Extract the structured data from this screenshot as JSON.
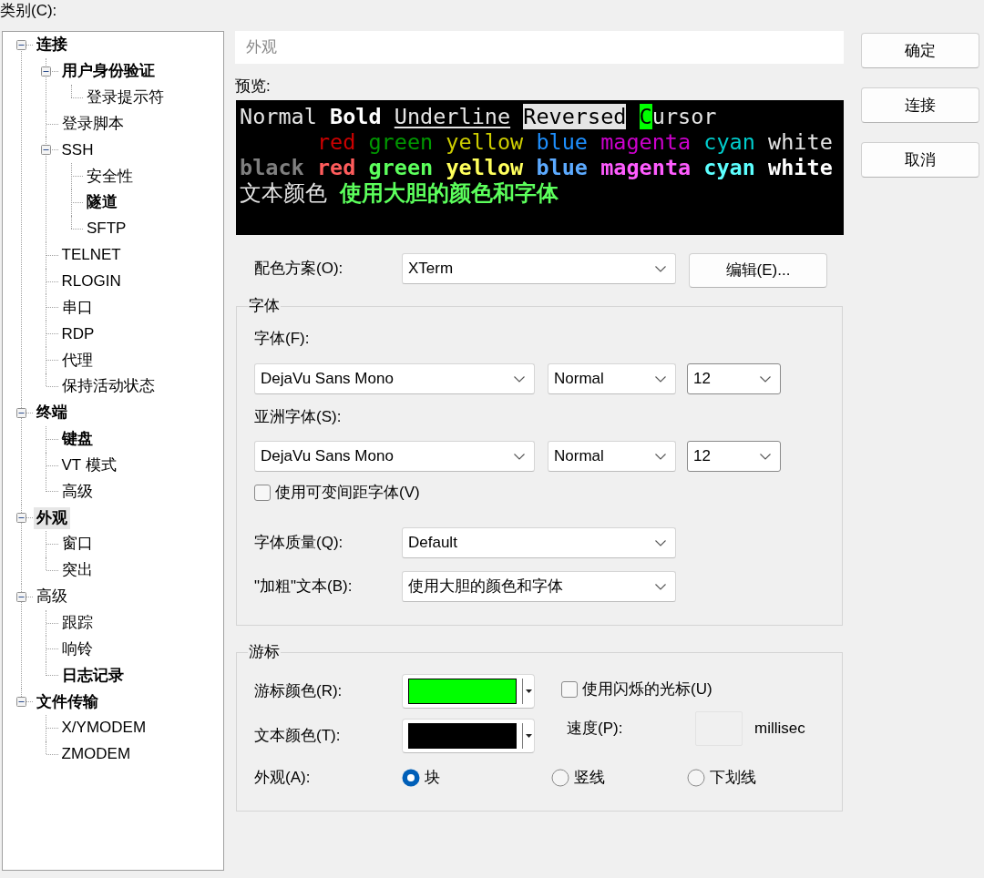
{
  "category_label": "类别(C):",
  "tree": [
    {
      "label": "连接",
      "bold": true,
      "selected": false,
      "expanded": true,
      "children": [
        {
          "label": "用户身份验证",
          "bold": true,
          "selected": false,
          "expanded": true,
          "children": [
            {
              "label": "登录提示符",
              "bold": false,
              "selected": false
            }
          ]
        },
        {
          "label": "登录脚本",
          "bold": false,
          "selected": false
        },
        {
          "label": "SSH",
          "bold": false,
          "selected": false,
          "expanded": true,
          "children": [
            {
              "label": "安全性",
              "bold": false,
              "selected": false
            },
            {
              "label": "隧道",
              "bold": true,
              "selected": false
            },
            {
              "label": "SFTP",
              "bold": false,
              "selected": false
            }
          ]
        },
        {
          "label": "TELNET",
          "bold": false,
          "selected": false
        },
        {
          "label": "RLOGIN",
          "bold": false,
          "selected": false
        },
        {
          "label": "串口",
          "bold": false,
          "selected": false
        },
        {
          "label": "RDP",
          "bold": false,
          "selected": false
        },
        {
          "label": "代理",
          "bold": false,
          "selected": false
        },
        {
          "label": "保持活动状态",
          "bold": false,
          "selected": false
        }
      ]
    },
    {
      "label": "终端",
      "bold": true,
      "selected": false,
      "expanded": true,
      "children": [
        {
          "label": "键盘",
          "bold": true,
          "selected": false
        },
        {
          "label": "VT 模式",
          "bold": false,
          "selected": false
        },
        {
          "label": "高级",
          "bold": false,
          "selected": false
        }
      ]
    },
    {
      "label": "外观",
      "bold": true,
      "selected": true,
      "expanded": true,
      "children": [
        {
          "label": "窗口",
          "bold": false,
          "selected": false
        },
        {
          "label": "突出",
          "bold": false,
          "selected": false
        }
      ]
    },
    {
      "label": "高级",
      "bold": false,
      "selected": false,
      "expanded": true,
      "children": [
        {
          "label": "跟踪",
          "bold": false,
          "selected": false
        },
        {
          "label": "响铃",
          "bold": false,
          "selected": false
        },
        {
          "label": "日志记录",
          "bold": true,
          "selected": false
        }
      ]
    },
    {
      "label": "文件传输",
      "bold": true,
      "selected": false,
      "expanded": true,
      "children": [
        {
          "label": "X/YMODEM",
          "bold": false,
          "selected": false
        },
        {
          "label": "ZMODEM",
          "bold": false,
          "selected": false
        }
      ]
    }
  ],
  "page_header": "外观",
  "preview": {
    "label": "预览:",
    "lines": [
      {
        "indented": false,
        "segments": [
          {
            "text": "Normal",
            "kind": "normal",
            "bold": false,
            "joined": false
          },
          {
            "text": "Bold",
            "kind": "normal",
            "bold": true,
            "joined": false
          },
          {
            "text": "Underline",
            "kind": "underline",
            "bold": false,
            "joined": false
          },
          {
            "text": "Reversed",
            "kind": "reversed",
            "bold": false,
            "joined": false
          },
          {
            "text": "C",
            "kind": "cursor",
            "bold": false,
            "joined": false
          },
          {
            "text": "ursor",
            "kind": "normal",
            "bold": false,
            "joined": true
          }
        ]
      },
      {
        "indented": true,
        "segments": [
          {
            "text": "red",
            "kind": "normal",
            "bold": false,
            "joined": false,
            "color": "#cd0000"
          },
          {
            "text": "green",
            "kind": "normal",
            "bold": false,
            "joined": false,
            "color": "#009900"
          },
          {
            "text": "yellow",
            "kind": "normal",
            "bold": false,
            "joined": false,
            "color": "#cdcd00"
          },
          {
            "text": "blue",
            "kind": "normal",
            "bold": false,
            "joined": false,
            "color": "#1e90ff"
          },
          {
            "text": "magenta",
            "kind": "normal",
            "bold": false,
            "joined": false,
            "color": "#cd00cd"
          },
          {
            "text": "cyan",
            "kind": "normal",
            "bold": false,
            "joined": false,
            "color": "#00cdcd"
          },
          {
            "text": "white",
            "kind": "normal",
            "bold": false,
            "joined": false,
            "color": "#e5e5e5"
          }
        ]
      },
      {
        "indented": false,
        "segments": [
          {
            "text": "black",
            "kind": "normal",
            "bold": true,
            "joined": false,
            "color": "#7f7f7f"
          },
          {
            "text": "red",
            "kind": "normal",
            "bold": true,
            "joined": false,
            "color": "#ff5c5c"
          },
          {
            "text": "green",
            "kind": "normal",
            "bold": true,
            "joined": false,
            "color": "#5cff5c"
          },
          {
            "text": "yellow",
            "kind": "normal",
            "bold": true,
            "joined": false,
            "color": "#ffff5c"
          },
          {
            "text": "blue",
            "kind": "normal",
            "bold": true,
            "joined": false,
            "color": "#5caaff"
          },
          {
            "text": "magenta",
            "kind": "normal",
            "bold": true,
            "joined": false,
            "color": "#ff5cff"
          },
          {
            "text": "cyan",
            "kind": "normal",
            "bold": true,
            "joined": false,
            "color": "#5cffff"
          },
          {
            "text": "white",
            "kind": "normal",
            "bold": true,
            "joined": false,
            "color": "#ffffff"
          }
        ]
      },
      {
        "indented": false,
        "segments": [
          {
            "text": "文本颜色",
            "kind": "normal",
            "bold": false,
            "joined": false
          },
          {
            "text": "使用大胆的颜色和字体",
            "kind": "normal",
            "bold": true,
            "joined": false,
            "color": "#5cff5c"
          }
        ]
      }
    ]
  },
  "color_scheme": {
    "label": "配色方案(O):",
    "value": "XTerm",
    "edit_button": "编辑(E)..."
  },
  "font_group": {
    "title": "字体",
    "font_label": "字体(F):",
    "font": {
      "face": "DejaVu Sans Mono",
      "style": "Normal",
      "size": "12"
    },
    "asian_label": "亚洲字体(S):",
    "asian_font": {
      "face": "DejaVu Sans Mono",
      "style": "Normal",
      "size": "12"
    },
    "variable_pitch": {
      "label": "使用可变间距字体(V)",
      "checked": false
    },
    "quality": {
      "label": "字体质量(Q):",
      "value": "Default"
    },
    "bold_text": {
      "label": "\"加粗\"文本(B):",
      "value": "使用大胆的颜色和字体"
    }
  },
  "cursor_group": {
    "title": "游标",
    "cursor_color": {
      "label": "游标颜色(R):",
      "color": "#00ff00"
    },
    "blink": {
      "label": "使用闪烁的光标(U)",
      "checked": false
    },
    "text_color": {
      "label": "文本颜色(T):",
      "color": "#000000"
    },
    "speed": {
      "label": "速度(P):",
      "disabled": true,
      "unit": "millisec"
    },
    "shape": {
      "label": "外观(A):",
      "options": [
        {
          "label": "块",
          "selected": true
        },
        {
          "label": "竖线",
          "selected": false
        },
        {
          "label": "下划线",
          "selected": false
        }
      ]
    }
  },
  "buttons": [
    "确定",
    "连接",
    "取消"
  ]
}
